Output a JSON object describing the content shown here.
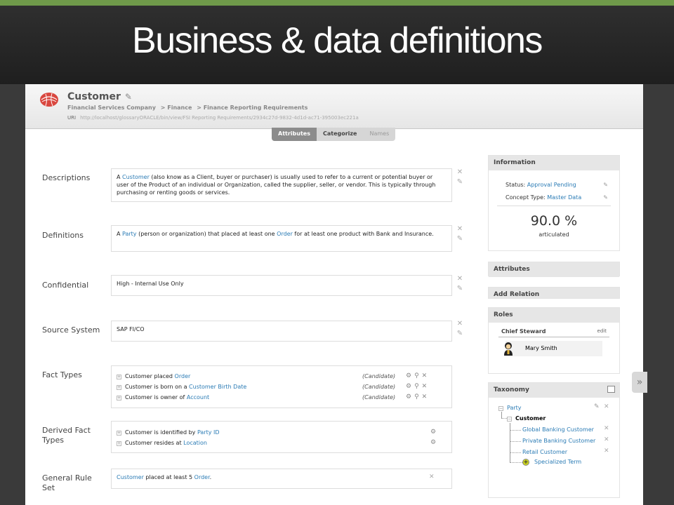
{
  "slide": {
    "title": "Business & data definitions"
  },
  "header": {
    "concept_title": "Customer",
    "breadcrumb": [
      "Financial Services Company",
      "> Finance",
      "> Finance Reporting Requirements"
    ],
    "uri_label": "URI",
    "uri_value": "http://localhost/glossaryORACLE/bin/view/FSI Reporting Requirements/2934c27d-9832-4d1d-ac71-395003ec221a"
  },
  "tabs": [
    {
      "label": "Attributes"
    },
    {
      "label": "Categorize"
    },
    {
      "label": "Names"
    }
  ],
  "fields": {
    "descriptions": {
      "label": "Descriptions",
      "text_pre": "A ",
      "link": "Customer",
      "text_post": " (also know as a Client, buyer or purchaser) is usually used to refer to a current or potential buyer or user of the Product of an individual or Organization, called the supplier, seller, or vendor. This is typically through purchasing or renting goods or services."
    },
    "definitions": {
      "label": "Definitions",
      "text_1": "A ",
      "link_1": "Party",
      "text_2": " (person or organization) that placed at least one ",
      "link_2": "Order",
      "text_3": " for at least one product with Bank and Insurance."
    },
    "confidential": {
      "label": "Confidential",
      "value": "High - Internal Use Only"
    },
    "source_system": {
      "label": "Source System",
      "value": "SAP FI/CO"
    },
    "fact_types": {
      "label": "Fact Types",
      "rows": [
        {
          "text": "Customer placed ",
          "link": "Order",
          "status": "(Candidate)"
        },
        {
          "text": "Customer is born on a ",
          "link": "Customer Birth Date",
          "status": "(Candidate)"
        },
        {
          "text": "Customer is owner of ",
          "link": "Account",
          "status": "(Candidate)"
        }
      ]
    },
    "derived_fact_types": {
      "label_1": "Derived Fact",
      "label_2": "Types",
      "rows": [
        {
          "text": "Customer is identified by ",
          "link": "Party ID"
        },
        {
          "text": "Customer resides at ",
          "link": "Location"
        }
      ]
    },
    "general_rule_set": {
      "label_1": "General Rule",
      "label_2": "Set",
      "link_1": "Customer",
      "text_1": " placed at least 5 ",
      "link_2": "Order",
      "text_2": "."
    }
  },
  "info_panel": {
    "title": "Information",
    "status_label": "Status: ",
    "status_value": "Approval Pending",
    "concept_type_label": "Concept Type: ",
    "concept_type_value": "Master Data",
    "percent": "90.0 %",
    "percent_label": "articulated"
  },
  "attributes_panel": {
    "title": "Attributes"
  },
  "add_relation_panel": {
    "title": "Add Relation"
  },
  "roles_panel": {
    "title": "Roles",
    "role_title": "Chief Steward",
    "edit_label": "edit",
    "user": "Mary Smith"
  },
  "taxonomy_panel": {
    "title": "Taxonomy",
    "parent": "Party",
    "current": "Customer",
    "children": [
      "Global Banking Customer",
      "Private Banking Customer",
      "Retail Customer"
    ],
    "add_label": "Specialized Term"
  },
  "colors": {
    "accent_green": "#6f9a4a",
    "link_blue": "#2a7bb5",
    "tab_active": "#8c8c8c"
  }
}
